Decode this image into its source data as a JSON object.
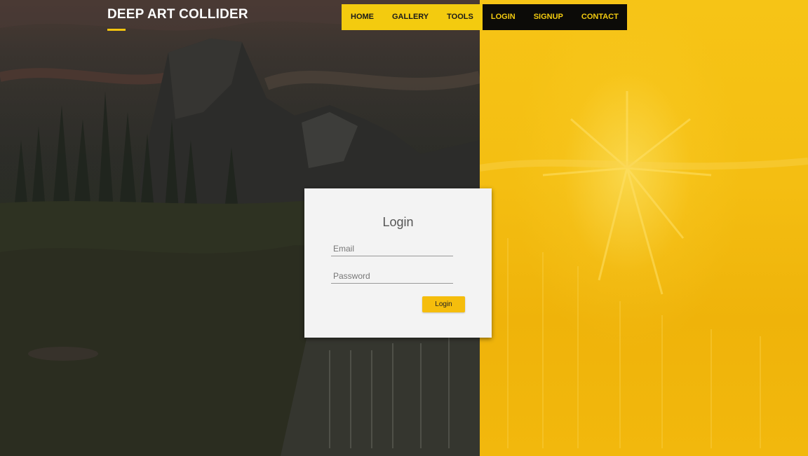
{
  "header": {
    "brand": "DEEP ART COLLIDER",
    "nav_primary": [
      {
        "label": "HOME"
      },
      {
        "label": "GALLERY"
      },
      {
        "label": "TOOLS"
      }
    ],
    "nav_secondary": [
      {
        "label": "LOGIN"
      },
      {
        "label": "SIGNUP"
      },
      {
        "label": "CONTACT"
      }
    ]
  },
  "login": {
    "title": "Login",
    "email_placeholder": "Email",
    "password_placeholder": "Password",
    "submit_label": "Login"
  },
  "colors": {
    "accent_yellow": "#f3cb0f",
    "nav_black": "#0c0b08",
    "button_yellow": "#f5bd0c"
  }
}
